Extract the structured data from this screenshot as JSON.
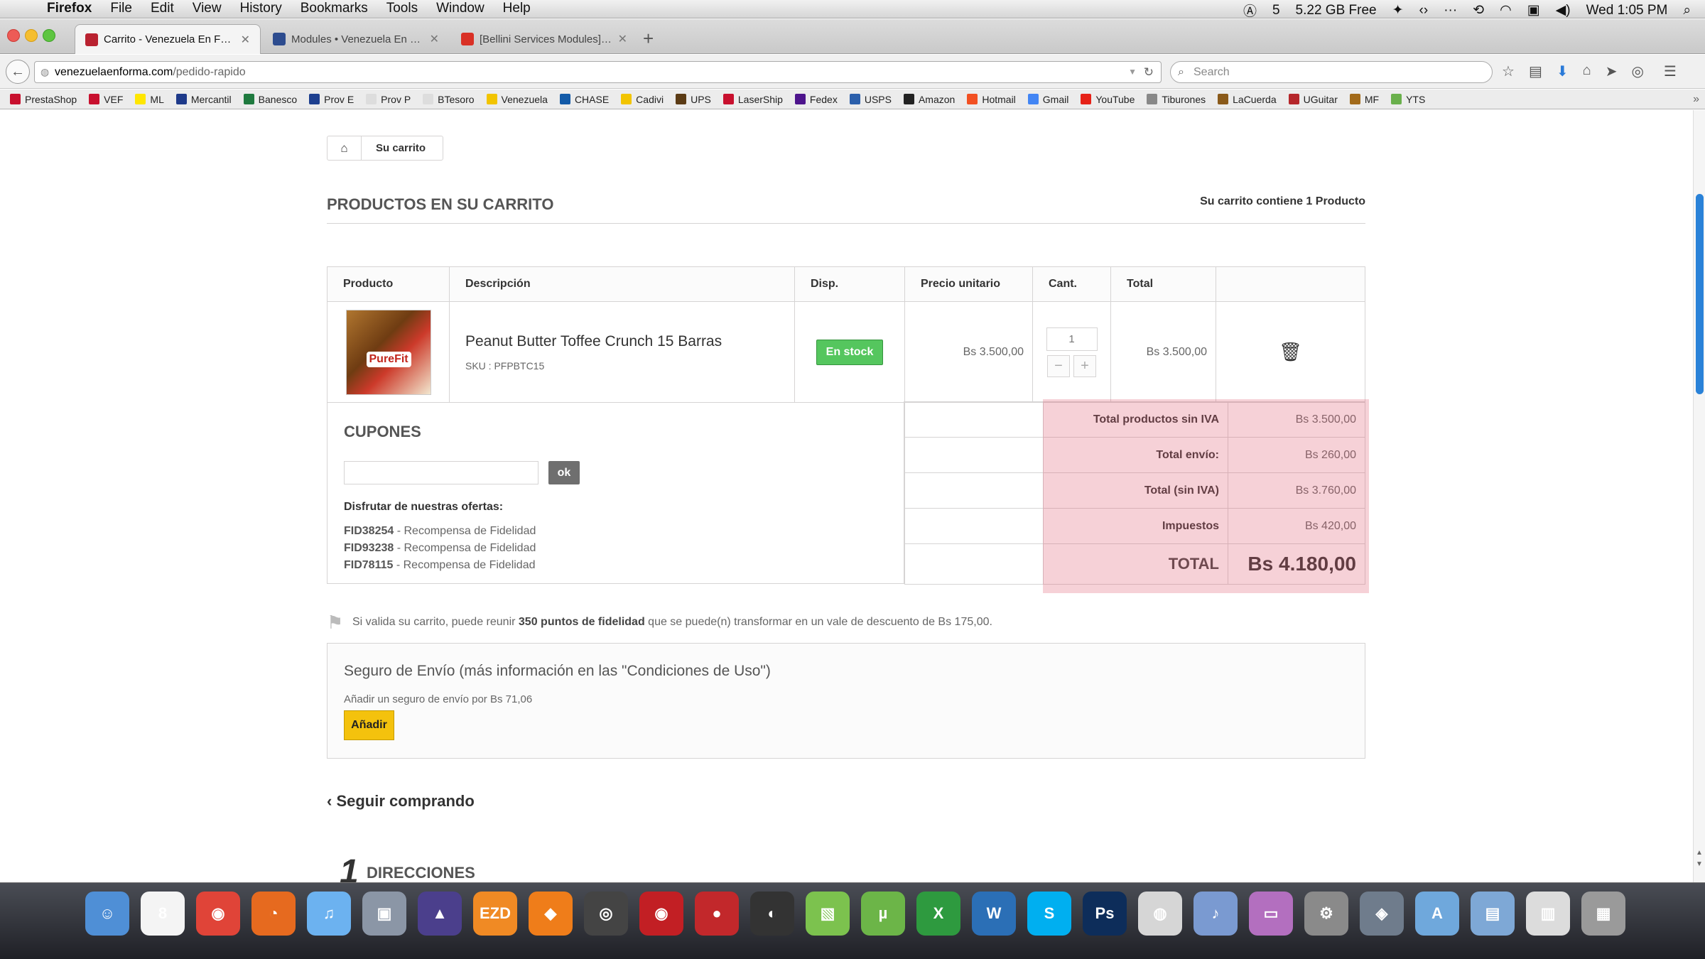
{
  "menubar": {
    "apple": "",
    "app": "Firefox",
    "menus": [
      "File",
      "Edit",
      "View",
      "History",
      "Bookmarks",
      "Tools",
      "Window",
      "Help"
    ],
    "status_count": "5",
    "disk_free": "5.22 GB Free",
    "clock": "Wed 1:05 PM"
  },
  "tabs": [
    {
      "label": "Carrito - Venezuela En Fo...",
      "color": "#b92230"
    },
    {
      "label": "Modules • Venezuela En F...",
      "color": "#2d4c8f"
    },
    {
      "label": "[Bellini Services Modules] ...",
      "color": "#d93025"
    }
  ],
  "url": {
    "host": "venezuelaenforma.com",
    "path": "/pedido-rapido"
  },
  "search": {
    "placeholder": "Search"
  },
  "bookmarks": [
    {
      "label": "PrestaShop",
      "color": "#c8102e"
    },
    {
      "label": "VEF",
      "color": "#c8102e"
    },
    {
      "label": "ML",
      "color": "#ffe600"
    },
    {
      "label": "Mercantil",
      "color": "#1e3a8a"
    },
    {
      "label": "Banesco",
      "color": "#1f7a3f"
    },
    {
      "label": "Prov E",
      "color": "#1d3f8f"
    },
    {
      "label": "Prov P",
      "color": "#dddddd"
    },
    {
      "label": "BTesoro",
      "color": "#dddddd"
    },
    {
      "label": "Venezuela",
      "color": "#f2c400"
    },
    {
      "label": "CHASE",
      "color": "#125aa8"
    },
    {
      "label": "Cadivi",
      "color": "#f2c400"
    },
    {
      "label": "UPS",
      "color": "#5b3b15"
    },
    {
      "label": "LaserShip",
      "color": "#c8102e"
    },
    {
      "label": "Fedex",
      "color": "#4d148c"
    },
    {
      "label": "USPS",
      "color": "#2b5fab"
    },
    {
      "label": "Amazon",
      "color": "#222222"
    },
    {
      "label": "Hotmail",
      "color": "#f25022"
    },
    {
      "label": "Gmail",
      "color": "#4285f4"
    },
    {
      "label": "YouTube",
      "color": "#e62117"
    },
    {
      "label": "Tiburones",
      "color": "#888888"
    },
    {
      "label": "LaCuerda",
      "color": "#8a5a1a"
    },
    {
      "label": "UGuitar",
      "color": "#b5262a"
    },
    {
      "label": "MF",
      "color": "#a26a1a"
    },
    {
      "label": "YTS",
      "color": "#6ab04c"
    }
  ],
  "breadcrumb": {
    "current": "Su carrito"
  },
  "page": {
    "title": "PRODUCTOS EN SU CARRITO",
    "summary": "Su carrito contiene 1 Producto"
  },
  "cart": {
    "headers": [
      "Producto",
      "Descripción",
      "Disp.",
      "Precio unitario",
      "Cant.",
      "Total",
      ""
    ],
    "item": {
      "image_text": "PureFit",
      "name": "Peanut Butter Toffee Crunch 15 Barras",
      "sku": "SKU : PFPBTC15",
      "availability": "En stock",
      "unit_price": "Bs 3.500,00",
      "qty": "1",
      "total": "Bs 3.500,00"
    }
  },
  "coupons": {
    "title": "CUPONES",
    "ok_label": "ok",
    "offers_label": "Disfrutar de nuestras ofertas:",
    "vouchers": [
      {
        "code": "FID38254",
        "desc": " - Recompensa de Fidelidad"
      },
      {
        "code": "FID93238",
        "desc": " - Recompensa de Fidelidad"
      },
      {
        "code": "FID78115",
        "desc": " - Recompensa de Fidelidad"
      }
    ]
  },
  "totals": [
    {
      "label": "Total productos sin IVA",
      "value": "Bs 3.500,00"
    },
    {
      "label": "Total envío:",
      "value": "Bs 260,00"
    },
    {
      "label": "Total (sin IVA)",
      "value": "Bs 3.760,00"
    },
    {
      "label": "Impuestos",
      "value": "Bs 420,00"
    },
    {
      "label": "TOTAL",
      "value": "Bs 4.180,00"
    }
  ],
  "loyalty": {
    "pre": "Si valida su carrito, puede reunir ",
    "points": "350 puntos de fidelidad",
    "post": " que se puede(n) transformar en un vale de descuento de Bs 175,00."
  },
  "insurance": {
    "title": "Seguro de Envío (más información en las \"Condiciones de Uso\")",
    "desc": "Añadir un seguro de envío por Bs 71,06",
    "button": "Añadir"
  },
  "continue_label": "Seguir comprando",
  "next_step": {
    "number": "1",
    "label": "DIRECCIONES"
  },
  "dock": [
    {
      "name": "finder",
      "label": "☺",
      "color": "#4f8fd6"
    },
    {
      "name": "calendar",
      "label": "8",
      "color": "#f4f4f4"
    },
    {
      "name": "chrome",
      "label": "◉",
      "color": "#e04438"
    },
    {
      "name": "firefox",
      "label": "◔",
      "color": "#e66a1f"
    },
    {
      "name": "itunes",
      "label": "♫",
      "color": "#6cb2f0"
    },
    {
      "name": "preview",
      "label": "▣",
      "color": "#8b96a6"
    },
    {
      "name": "logic",
      "label": "▲",
      "color": "#4b3f8c"
    },
    {
      "name": "ezd",
      "label": "EZD",
      "color": "#f08a24"
    },
    {
      "name": "reason",
      "label": "◆",
      "color": "#ef7d1a"
    },
    {
      "name": "app-9",
      "label": "◎",
      "color": "#444444"
    },
    {
      "name": "app-10",
      "label": "◉",
      "color": "#c21f24"
    },
    {
      "name": "app-11",
      "label": "●",
      "color": "#c2282b"
    },
    {
      "name": "app-12",
      "label": "◐",
      "color": "#333333"
    },
    {
      "name": "app-13",
      "label": "▧",
      "color": "#7cc24e"
    },
    {
      "name": "utorrent",
      "label": "µ",
      "color": "#6cb548"
    },
    {
      "name": "excel",
      "label": "X",
      "color": "#2e9a3f"
    },
    {
      "name": "word",
      "label": "W",
      "color": "#2b6fb6"
    },
    {
      "name": "skype",
      "label": "S",
      "color": "#00aff0"
    },
    {
      "name": "photoshop",
      "label": "Ps",
      "color": "#0d2d5a"
    },
    {
      "name": "app-20",
      "label": "◍",
      "color": "#d6d6d6"
    },
    {
      "name": "app-21",
      "label": "♪",
      "color": "#7a9ad1"
    },
    {
      "name": "app-22",
      "label": "▭",
      "color": "#b36fbf"
    },
    {
      "name": "system-prefs",
      "label": "⚙",
      "color": "#8a8a8a"
    },
    {
      "name": "app-24",
      "label": "◈",
      "color": "#6f7c8c"
    },
    {
      "name": "app-store",
      "label": "A",
      "color": "#6fa8dc"
    },
    {
      "name": "folder",
      "label": "▤",
      "color": "#7ea8d6"
    },
    {
      "name": "app-27",
      "label": "▥",
      "color": "#dcdcdc"
    },
    {
      "name": "trash",
      "label": "▦",
      "color": "#9a9a9a"
    }
  ]
}
